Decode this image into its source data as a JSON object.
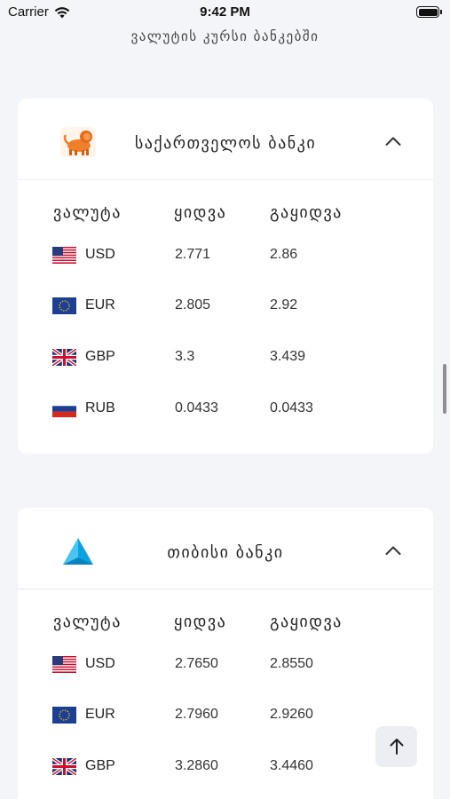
{
  "status_bar": {
    "carrier": "Carrier",
    "time": "9:42 PM"
  },
  "page_title": "ვალუტის კურსი ბანკებში",
  "columns": {
    "currency": "ვალუტა",
    "buy": "ყიდვა",
    "sell": "გაყიდვა"
  },
  "banks": [
    {
      "name": "საქართველოს ბანკი",
      "logo_icon": "lion-logo-icon",
      "expanded": true,
      "rates": [
        {
          "code": "USD",
          "flag": "us-flag-icon",
          "buy": "2.771",
          "sell": "2.86"
        },
        {
          "code": "EUR",
          "flag": "eu-flag-icon",
          "buy": "2.805",
          "sell": "2.92"
        },
        {
          "code": "GBP",
          "flag": "uk-flag-icon",
          "buy": "3.3",
          "sell": "3.439"
        },
        {
          "code": "RUB",
          "flag": "ru-flag-icon",
          "buy": "0.0433",
          "sell": "0.0433"
        }
      ]
    },
    {
      "name": "თიბისი ბანკი",
      "logo_icon": "triangle-logo-icon",
      "expanded": true,
      "rates": [
        {
          "code": "USD",
          "flag": "us-flag-icon",
          "buy": "2.7650",
          "sell": "2.8550"
        },
        {
          "code": "EUR",
          "flag": "eu-flag-icon",
          "buy": "2.7960",
          "sell": "2.9260"
        },
        {
          "code": "GBP",
          "flag": "uk-flag-icon",
          "buy": "3.2860",
          "sell": "3.4460"
        }
      ]
    }
  ],
  "icons": {
    "chevron": "chevron-up-icon",
    "scroll_top": "arrow-up-icon",
    "wifi": "wifi-icon",
    "battery": "battery-icon"
  }
}
